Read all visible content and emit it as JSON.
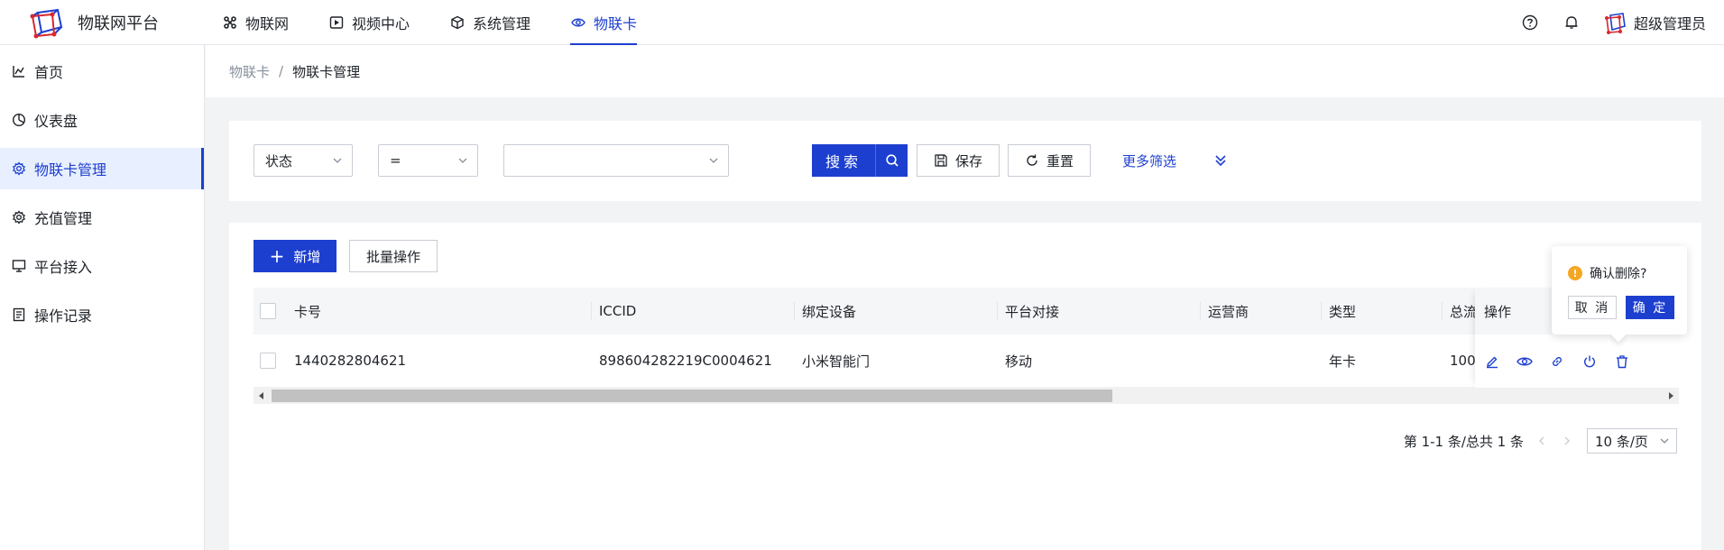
{
  "app": {
    "name": "物联网平台"
  },
  "nav": [
    {
      "label": "物联网",
      "icon": "grid-icon"
    },
    {
      "label": "视频中心",
      "icon": "video-icon"
    },
    {
      "label": "系统管理",
      "icon": "cube-icon"
    },
    {
      "label": "物联卡",
      "icon": "eye-icon",
      "active": true
    }
  ],
  "user": {
    "name": "超级管理员"
  },
  "sidebar": {
    "items": [
      {
        "label": "首页",
        "icon": "chart-icon"
      },
      {
        "label": "仪表盘",
        "icon": "pie-icon"
      },
      {
        "label": "物联卡管理",
        "icon": "gear-icon",
        "active": true
      },
      {
        "label": "充值管理",
        "icon": "gear-icon"
      },
      {
        "label": "平台接入",
        "icon": "monitor-icon"
      },
      {
        "label": "操作记录",
        "icon": "record-icon"
      }
    ]
  },
  "breadcrumb": {
    "parent": "物联卡",
    "separator": "/",
    "current": "物联卡管理"
  },
  "filter": {
    "field": "状态",
    "operator": "=",
    "value": "",
    "search_label": "搜索",
    "save_label": "保存",
    "reset_label": "重置",
    "more_label": "更多筛选"
  },
  "toolbar": {
    "add_label": "新增",
    "batch_label": "批量操作"
  },
  "table": {
    "headers": {
      "card_no": "卡号",
      "iccid": "ICCID",
      "device": "绑定设备",
      "platform": "平台对接",
      "operator": "运营商",
      "type": "类型",
      "total": "总流",
      "actions": "操作"
    },
    "rows": [
      {
        "card_no": "1440282804621",
        "iccid": "898604282219C0004621",
        "device": "小米智能门",
        "platform": "移动",
        "operator": "",
        "type": "年卡",
        "total": "100"
      }
    ]
  },
  "pagination": {
    "summary": "第 1-1 条/总共 1 条",
    "page_size": "10 条/页"
  },
  "popconfirm": {
    "title": "确认删除?",
    "cancel": "取 消",
    "ok": "确 定"
  },
  "colors": {
    "primary": "#1d3fcf",
    "warning": "#f5a623"
  }
}
